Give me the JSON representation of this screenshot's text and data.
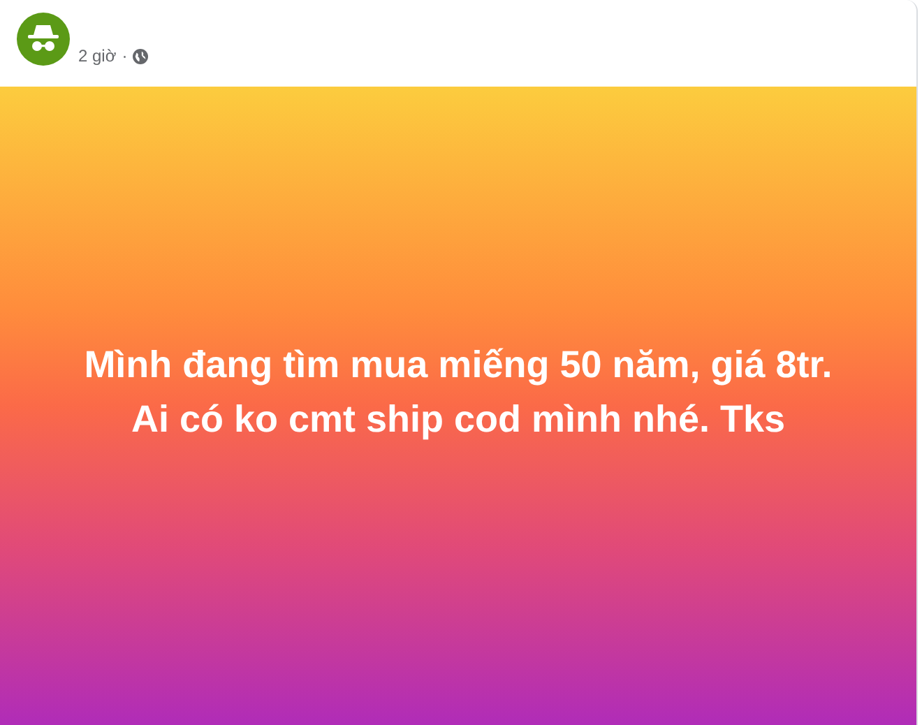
{
  "post": {
    "time": "2 giờ",
    "separator": "·",
    "lines": [
      "Mình đang tìm mua miếng 50 năm, giá 8tr.",
      "Ai có ko cmt ship cod mình nhé. Tks"
    ]
  }
}
